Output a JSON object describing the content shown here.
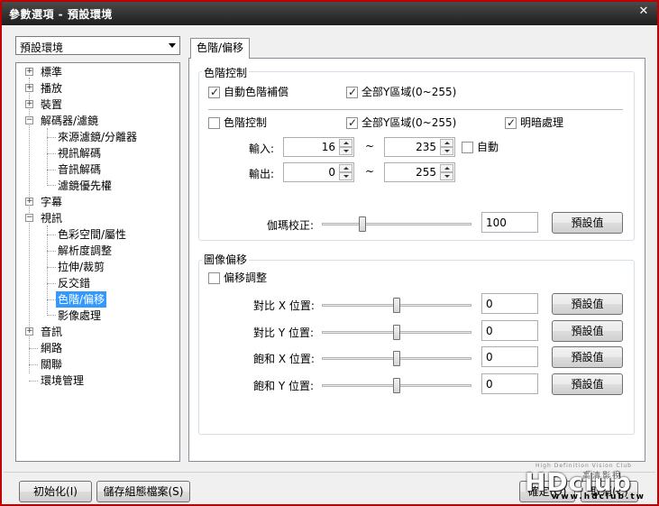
{
  "window": {
    "title": "參數選項 - 預設環境",
    "close_glyph": "✕"
  },
  "profile": {
    "selected": "預設環境"
  },
  "tree": {
    "items": [
      {
        "label": "標準",
        "expander": "+"
      },
      {
        "label": "播放",
        "expander": "+"
      },
      {
        "label": "裝置",
        "expander": "+"
      },
      {
        "label": "解碼器/濾鏡",
        "expander": "−"
      },
      {
        "label": "來源濾鏡/分離器"
      },
      {
        "label": "視訊解碼"
      },
      {
        "label": "音訊解碼"
      },
      {
        "label": "濾鏡優先權"
      },
      {
        "label": "字幕",
        "expander": "+"
      },
      {
        "label": "視訊",
        "expander": "−"
      },
      {
        "label": "色彩空間/屬性"
      },
      {
        "label": "解析度調整"
      },
      {
        "label": "拉伸/裁剪"
      },
      {
        "label": "反交錯"
      },
      {
        "label": "色階/偏移",
        "selected": true
      },
      {
        "label": "影像處理"
      },
      {
        "label": "音訊",
        "expander": "+"
      },
      {
        "label": "網路"
      },
      {
        "label": "關聯"
      },
      {
        "label": "環境管理"
      }
    ]
  },
  "tab": {
    "label": "色階/偏移"
  },
  "levels": {
    "group_title": "色階控制",
    "auto_compensate": {
      "label": "自動色階補償",
      "checked": true
    },
    "full_range_top": {
      "label": "全部Y區域(0~255)",
      "checked": true
    },
    "level_control": {
      "label": "色階控制",
      "checked": false
    },
    "full_range_mid": {
      "label": "全部Y區域(0~255)",
      "checked": true
    },
    "brightness": {
      "label": "明暗處理",
      "checked": true
    },
    "input_label": "輸入:",
    "input_low": "16",
    "input_high": "235",
    "tilde1": "~",
    "auto": {
      "label": "自動",
      "checked": false
    },
    "output_label": "輸出:",
    "output_low": "0",
    "output_high": "255",
    "tilde2": "~",
    "gamma_label": "伽瑪校正:",
    "gamma_value": "100",
    "gamma_slider_fraction": 0.26,
    "default_label": "預設值"
  },
  "offset": {
    "group_title": "圖像偏移",
    "enable": {
      "label": "偏移調整",
      "checked": false
    },
    "rows": [
      {
        "label": "對比 X 位置:",
        "value": "0",
        "fraction": 0.5,
        "button": "預設值"
      },
      {
        "label": "對比 Y 位置:",
        "value": "0",
        "fraction": 0.5,
        "button": "預設值"
      },
      {
        "label": "飽和 X 位置:",
        "value": "0",
        "fraction": 0.5,
        "button": "預設值"
      },
      {
        "label": "飽和 Y 位置:",
        "value": "0",
        "fraction": 0.5,
        "button": "預設值"
      }
    ]
  },
  "footer": {
    "init_label": "初始化(I)",
    "save_label": "儲存組態檔案(S)",
    "ok_label": "確定(O)",
    "cancel_label": "取消(C)"
  },
  "watermark": {
    "brand": "HDclub",
    "tag": "High Definition Vision Club",
    "sub": "高清影視",
    "url": "www.hdclub.tw"
  }
}
